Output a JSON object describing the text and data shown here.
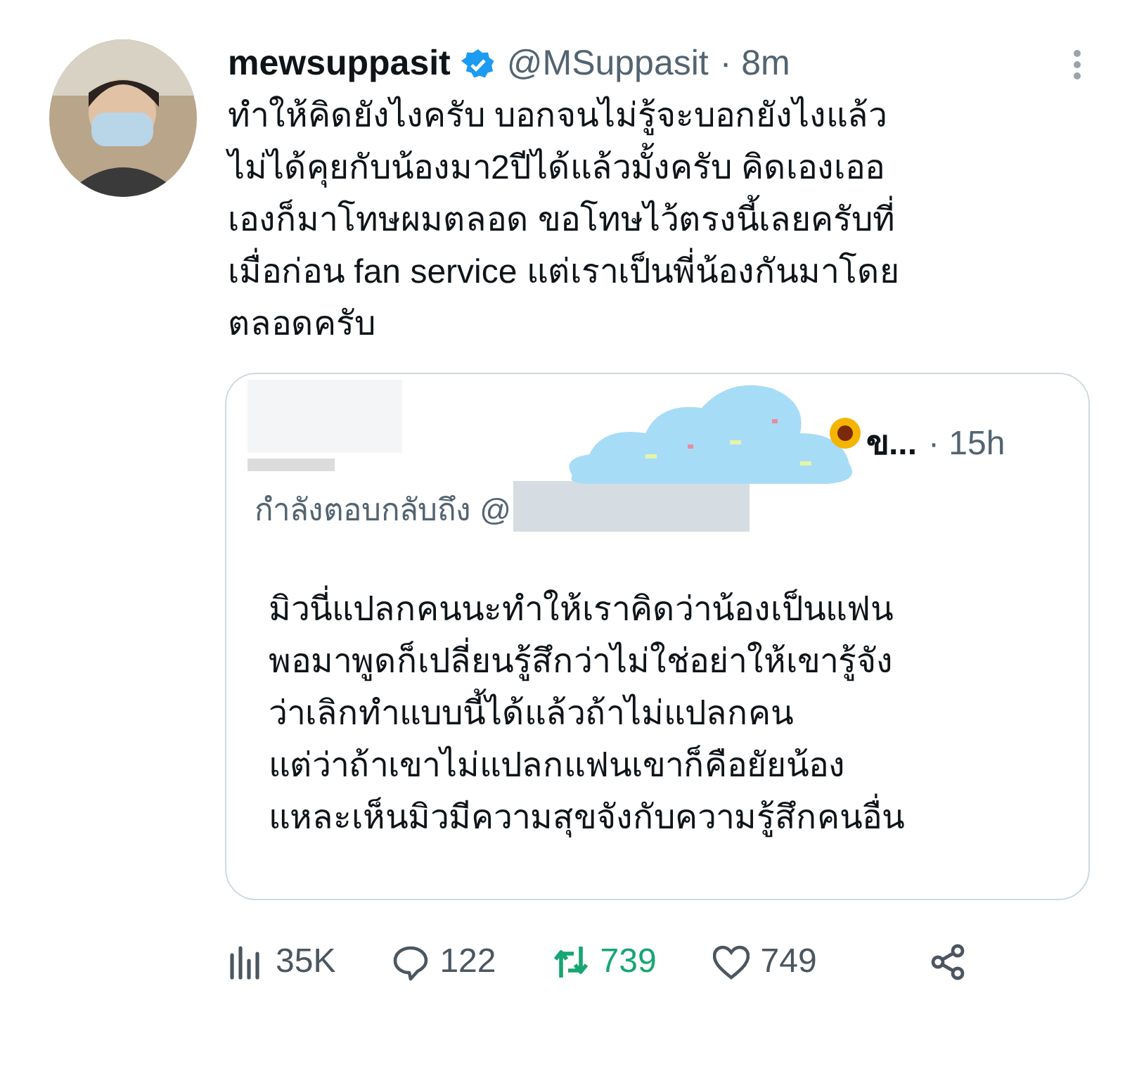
{
  "tweet": {
    "display_name": "mewsuppasit",
    "verified": true,
    "handle": "@MSuppasit",
    "time": "· 8m",
    "text": "ทำให้คิดยังไงครับ บอกจนไม่รู้จะบอกยังไงแล้ว\nไม่ได้คุยกับน้องมา2ปีได้แล้วมั้งครับ คิดเองเออ\nเองก็มาโทษผมตลอด ขอโทษไว้ตรงนี้เลยครับที่\nเมื่อก่อน fan service แต่เราเป็นพี่น้องกันมาโดย\nตลอดครับ",
    "quoted": {
      "name_tail": "ข...",
      "time": "· 15h",
      "replying_to": "กำลังตอบกลับถึง @",
      "text": "มิวนี่แปลกคนนะทำให้เราคิดว่าน้องเป็นแฟน\nพอมาพูดก็เปลี่ยนรู้สึกว่าไม่ใช่อย่าให้เขารู้จัง\nว่าเลิกทำแบบนี้ได้แล้วถ้าไม่แปลกคน\nแต่ว่าถ้าเขาไม่แปลกแฟนเขาก็คือยัยน้อง\nแหละเห็นมิวมีความสุขจังกับความรู้สึกคนอื่น"
    },
    "actions": [
      {
        "kind": "views",
        "count": "35K",
        "selected": false
      },
      {
        "kind": "reply",
        "count": "122",
        "selected": false
      },
      {
        "kind": "retweet",
        "count": "739",
        "selected": true
      },
      {
        "kind": "like",
        "count": "749",
        "selected": false
      },
      {
        "kind": "share"
      }
    ]
  }
}
